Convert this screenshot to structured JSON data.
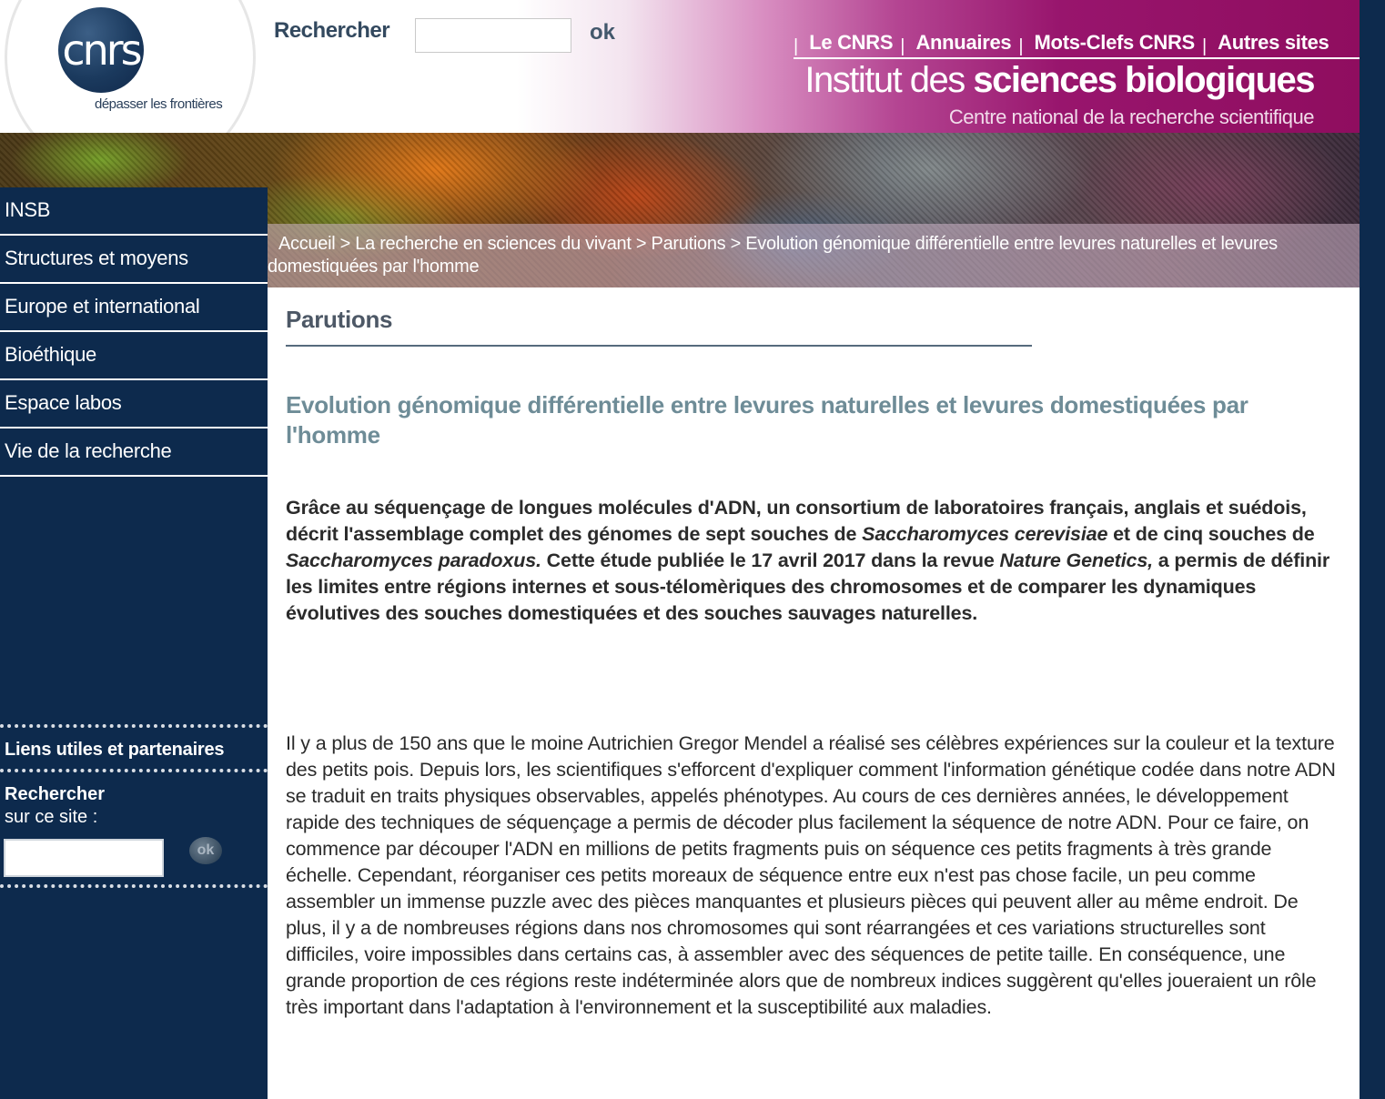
{
  "header": {
    "logo_text": "cnrs",
    "logo_tagline": "dépasser les frontières",
    "search_label": "Rechercher",
    "search_value": "",
    "search_ok": "ok",
    "top_links": [
      "Le CNRS",
      "Annuaires",
      "Mots-Clefs CNRS",
      "Autres sites"
    ],
    "institute_light": "Institut des",
    "institute_bold": "sciences biologiques",
    "institute_sub": "Centre national de la recherche scientifique"
  },
  "breadcrumb": {
    "items": [
      "Accueil",
      "La recherche en sciences du vivant",
      "Parutions",
      "Evolution génomique différentielle entre levures naturelles et levures domestiquées par l'homme"
    ],
    "separator": ">"
  },
  "sidebar": {
    "items": [
      "INSB",
      "Structures et moyens",
      "Europe et international",
      "Bioéthique",
      "Espace labos",
      "Vie de la recherche"
    ],
    "links_label": "Liens utiles et partenaires",
    "search_title": "Rechercher",
    "search_sub": "sur ce site :",
    "search_value": "",
    "search_ok": "ok"
  },
  "main": {
    "section_title": "Parutions",
    "article_title": "Evolution génomique différentielle entre levures naturelles et levures domestiquées par l'homme",
    "lead": {
      "p1": "Grâce au séquençage de longues molécules d'ADN, un consortium de laboratoires français, anglais et suédois, décrit l'assemblage complet des génomes de sept souches de ",
      "em1": "Saccharomyces cerevisiae",
      "p2": " et de cinq souches de ",
      "em2": "Saccharomyces paradoxus.",
      "p3": " Cette étude publiée le 17 avril 2017 dans la revue ",
      "em3": "Nature Genetics,",
      "p4": " a permis de définir les limites entre régions internes et sous-télomèriques des chromosomes et de comparer les dynamiques évolutives des souches domestiquées et des souches sauvages naturelles."
    },
    "body": "Il y a plus de 150 ans que le moine Autrichien Gregor Mendel a réalisé ses célèbres expériences sur la couleur et la texture des petits pois. Depuis lors, les scientifiques s'efforcent d'expliquer comment l'information génétique codée dans notre ADN se traduit en traits physiques observables, appelés phénotypes. Au cours de ces dernières années, le développement rapide des techniques de séquençage a permis de décoder plus facilement la séquence de notre ADN. Pour ce faire, on commence par découper l'ADN en millions de petits fragments puis on séquence ces petits fragments à très grande échelle. Cependant, réorganiser ces petits moreaux de séquence entre eux n'est pas chose facile, un peu comme assembler un immense puzzle avec des pièces manquantes et plusieurs pièces qui peuvent aller au même endroit. De plus, il y a de nombreuses régions dans nos chromosomes qui sont réarrangées et ces variations structurelles sont difficiles, voire impossibles dans certains cas, à assembler avec des séquences de petite taille. En conséquence, une grande proportion de ces régions reste indéterminée alors que de nombreux indices suggèrent qu'elles joueraient un rôle très important dans l'adaptation à l'environnement et la susceptibilité aux maladies."
  },
  "colors": {
    "navy": "#0d2a4d",
    "magenta": "#8f0d5f",
    "title_teal": "#6e8c97"
  }
}
